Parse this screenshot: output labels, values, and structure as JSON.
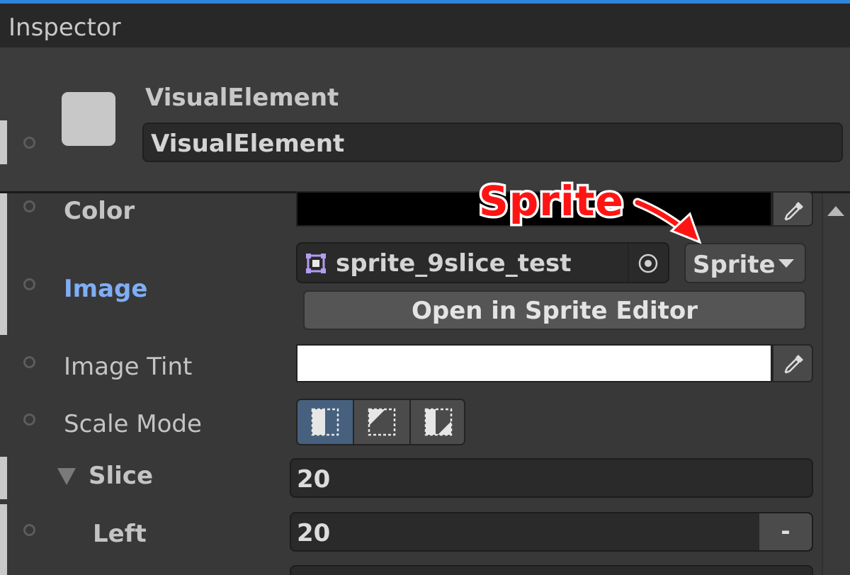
{
  "window": {
    "tab_title": "Inspector"
  },
  "header": {
    "element_type": "VisualElement",
    "element_name": "VisualElement"
  },
  "properties": {
    "color": {
      "label": "Color",
      "value": "#000000"
    },
    "image": {
      "label": "Image",
      "asset_name": "sprite_9slice_test",
      "asset_icon": "sprite-asset-icon",
      "type_selected": "Sprite",
      "open_editor_label": "Open in Sprite Editor"
    },
    "image_tint": {
      "label": "Image Tint",
      "value": "#ffffff"
    },
    "scale_mode": {
      "label": "Scale Mode",
      "options": [
        "stretch-to-fill-icon",
        "scale-and-crop-icon",
        "scale-to-fit-icon"
      ],
      "selected_index": 0
    },
    "slice": {
      "label": "Slice",
      "value": "20",
      "expanded": true
    },
    "slice_left": {
      "label": "Left",
      "value": "20",
      "minus_label": "-"
    }
  },
  "annotation": {
    "text": "Sprite",
    "color": "#ff1414"
  },
  "colors": {
    "accent": "#2f86d8",
    "selected_segment": "#46607e",
    "override_label": "#7faef5"
  }
}
